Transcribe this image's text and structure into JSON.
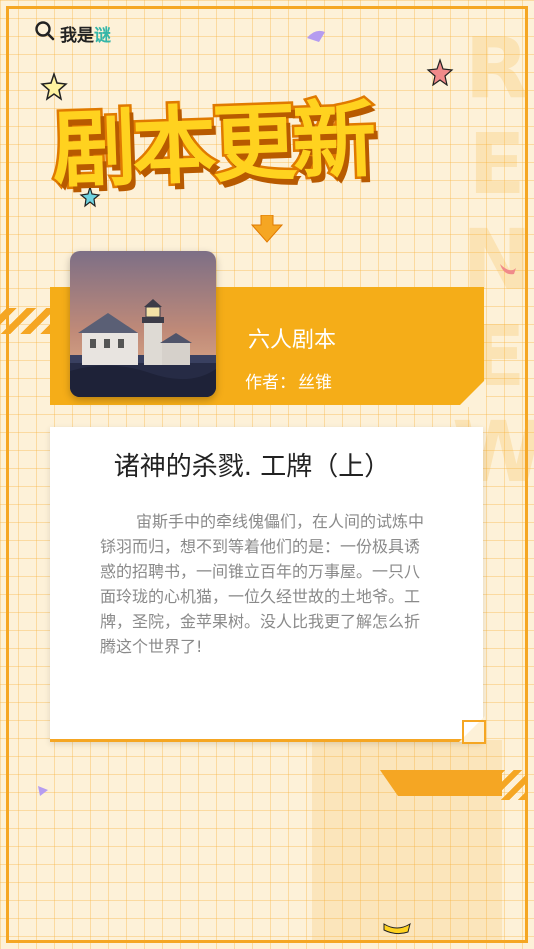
{
  "logo": {
    "prefix": "我是",
    "accent": "谜"
  },
  "header": {
    "title": "剧本更新",
    "watermark": "RENEW"
  },
  "book": {
    "category": "六人剧本",
    "author_label": "作者：",
    "author_name": "丝锥"
  },
  "script": {
    "title": "诸神的杀戮. 工牌（上）",
    "description": "宙斯手中的牵线傀儡们，在人间的试炼中铩羽而归，想不到等着他们的是：一份极具诱惑的招聘书，一间锥立百年的万事屋。一只八面玲珑的心机猫，一位久经世故的土地爷。工牌，圣院，金苹果树。没人比我更了解怎么折腾这个世界了!"
  },
  "colors": {
    "accent": "#f5ad18",
    "title_fill": "#ffd21f",
    "title_stroke": "#e07a00",
    "logo_accent": "#35b6a8"
  },
  "icons": [
    "search-icon",
    "arrow-down-icon",
    "star-icon",
    "lighthouse-image"
  ]
}
